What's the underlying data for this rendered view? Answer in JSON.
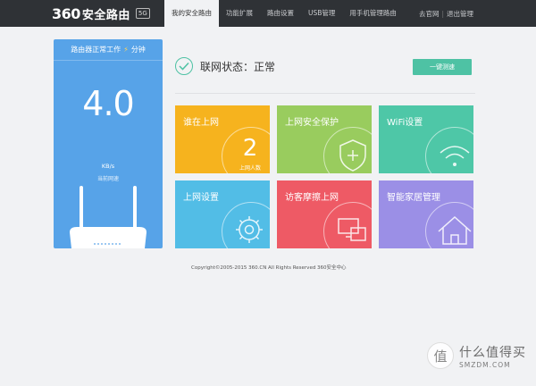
{
  "header": {
    "logo_number": "360",
    "logo_text": "安全路由",
    "logo_badge": "5G",
    "nav": [
      {
        "label": "我的安全路由",
        "active": true
      },
      {
        "label": "功能扩展",
        "active": false
      },
      {
        "label": "路由设置",
        "active": false
      },
      {
        "label": "USB管理",
        "active": false
      },
      {
        "label": "用手机管理路由",
        "active": false
      }
    ],
    "right": {
      "link1": "去官网",
      "sep": "|",
      "link2": "退出管理"
    }
  },
  "status_panel": {
    "head_left": "路由器正常工作",
    "head_icon": "⚡",
    "head_right": "分钟",
    "speed_value": "4.0",
    "speed_unit": "KB/s",
    "speed_label": "当前网速",
    "bg_color": "#57a3e8"
  },
  "net": {
    "status_text": "联网状态：正常",
    "speedtest_label": "一键测速",
    "accent": "#4ec2a4"
  },
  "tiles": [
    {
      "label": "谁在上网",
      "color": "#f6b31e",
      "icon": "users-count",
      "count": "2",
      "count_caption": "上网人数"
    },
    {
      "label": "上网安全保护",
      "color": "#99cc5e",
      "icon": "shield-plus-icon"
    },
    {
      "label": "WiFi设置",
      "color": "#4ec7a7",
      "icon": "wifi-icon"
    },
    {
      "label": "上网设置",
      "color": "#52bde6",
      "icon": "gear-icon"
    },
    {
      "label": "访客摩擦上网",
      "color": "#ee5a65",
      "icon": "devices-icon"
    },
    {
      "label": "智能家居管理",
      "color": "#9b8fe6",
      "icon": "house-icon"
    }
  ],
  "footer": {
    "copyright": "Copyright©2005-2015 360.CN All Rights Reserved 360安全中心"
  },
  "watermark": {
    "glyph": "值",
    "title": "什么值得买",
    "sub": "SMZDM.COM"
  }
}
